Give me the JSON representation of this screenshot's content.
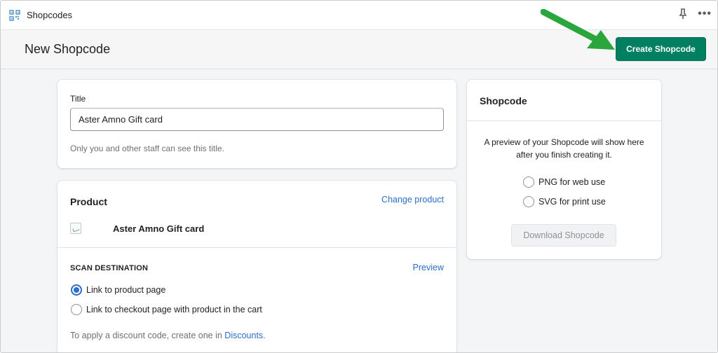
{
  "app": {
    "name": "Shopcodes",
    "icon": "qr-code-icon",
    "actions": [
      "pin-icon",
      "more-icon"
    ]
  },
  "header": {
    "title": "New Shopcode",
    "primary_button": "Create Shopcode",
    "annotation": "green-arrow-icon"
  },
  "colors": {
    "primary": "#008060",
    "link": "#2c6ecb",
    "annotation_arrow": "#2aa63c"
  },
  "title_card": {
    "label": "Title",
    "value": "Aster Amno Gift card",
    "help": "Only you and other staff can see this title."
  },
  "product_card": {
    "heading": "Product",
    "change_link": "Change product",
    "product_name": "Aster Amno Gift card",
    "scan_heading": "SCAN DESTINATION",
    "preview_link": "Preview",
    "options": [
      {
        "label": "Link to product page",
        "checked": true
      },
      {
        "label": "Link to checkout page with product in the cart",
        "checked": false
      }
    ],
    "discount_prefix": "To apply a discount code, create one in",
    "discount_link": "Discounts",
    "discount_suffix": "."
  },
  "shopcode_card": {
    "heading": "Shopcode",
    "preview_text": "A preview of your Shopcode will show here after you finish creating it.",
    "formats": [
      {
        "label": "PNG for web use",
        "checked": false
      },
      {
        "label": "SVG for print use",
        "checked": false
      }
    ],
    "download_button": "Download Shopcode"
  }
}
